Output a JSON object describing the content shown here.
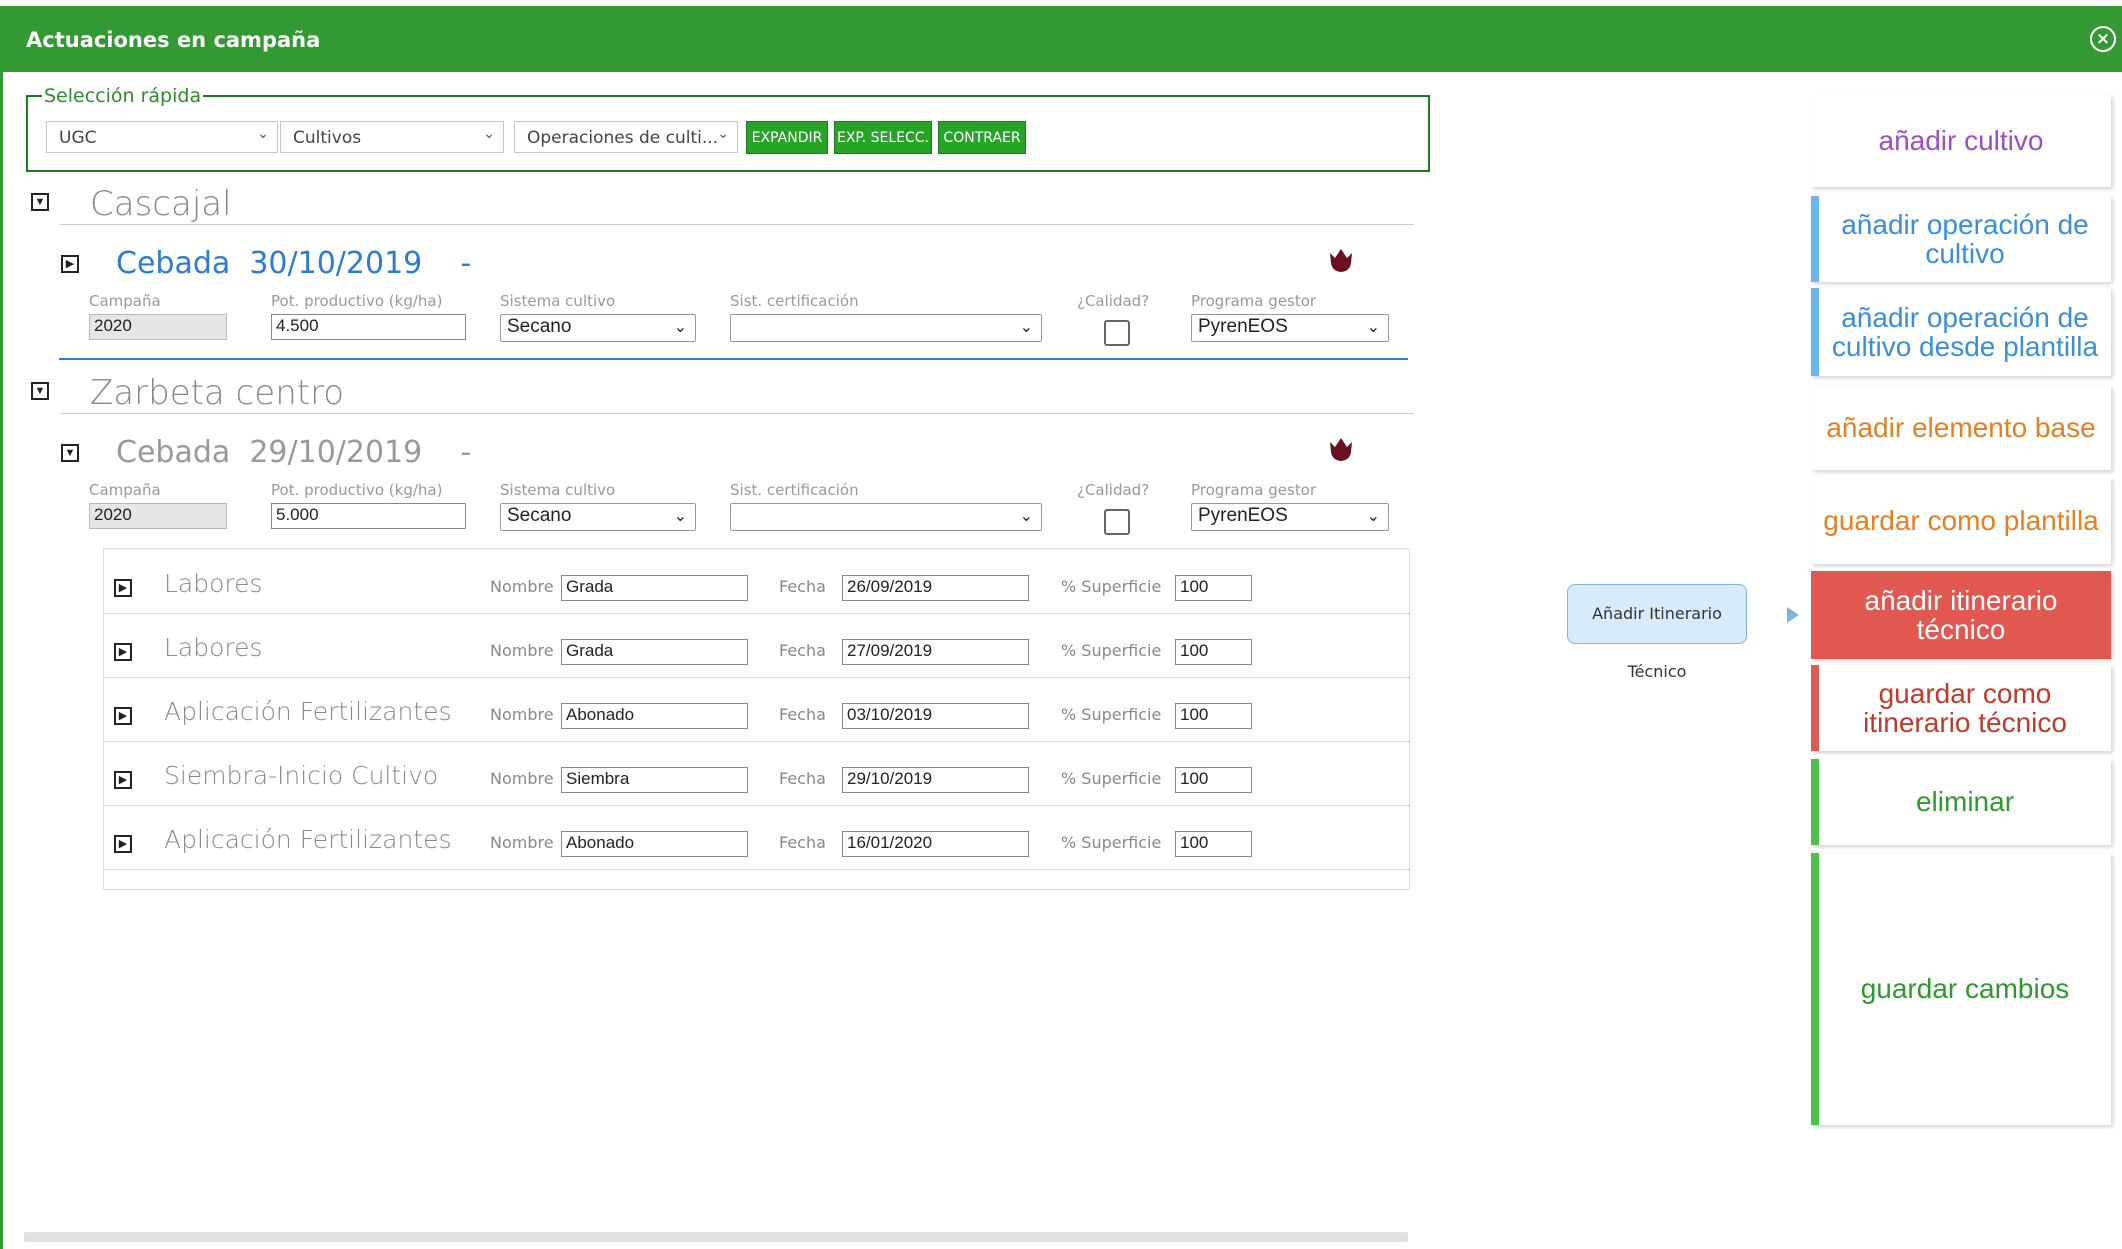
{
  "header": {
    "title": "Actuaciones en campaña",
    "close_icon": "close-circle-icon"
  },
  "quick_select": {
    "legend": "Selección rápida",
    "filters": [
      {
        "value": "UGC"
      },
      {
        "value": "Cultivos"
      },
      {
        "value": "Operaciones de culti..."
      }
    ],
    "buttons": [
      "EXPANDIR",
      "EXP. SELECC.",
      "CONTRAER"
    ]
  },
  "labels": {
    "campana": "Campaña",
    "pot": "Pot. productivo (kg/ha)",
    "sistema": "Sistema cultivo",
    "cert": "Sist. certificación",
    "calidad": "¿Calidad?",
    "programa": "Programa gestor",
    "nombre": "Nombre",
    "fecha": "Fecha",
    "superficie": "% Superficie"
  },
  "sections": [
    {
      "name": "Cascajal",
      "crop": {
        "name": "Cebada",
        "date": "30/10/2019",
        "dash": "-",
        "campana": "2020",
        "pot": "4.500",
        "sistema": "Secano",
        "cert": "",
        "programa": "PyrenEOS"
      }
    },
    {
      "name": "Zarbeta centro",
      "crop": {
        "name": "Cebada",
        "date": "29/10/2019",
        "dash": "-",
        "campana": "2020",
        "pot": "5.000",
        "sistema": "Secano",
        "cert": "",
        "programa": "PyrenEOS"
      }
    }
  ],
  "operations": [
    {
      "type": "Labores",
      "nombre": "Grada",
      "fecha": "26/09/2019",
      "superficie": "100"
    },
    {
      "type": "Labores",
      "nombre": "Grada",
      "fecha": "27/09/2019",
      "superficie": "100"
    },
    {
      "type": "Aplicación Fertilizantes",
      "nombre": "Abonado",
      "fecha": "03/10/2019",
      "superficie": "100"
    },
    {
      "type": "Siembra-Inicio Cultivo",
      "nombre": "Siembra",
      "fecha": "29/10/2019",
      "superficie": "100"
    },
    {
      "type": "Aplicación Fertilizantes",
      "nombre": "Abonado",
      "fecha": "16/01/2020",
      "superficie": "100"
    }
  ],
  "actions": [
    "añadir cultivo",
    "añadir operación de cultivo",
    "añadir operación de cultivo desde plantilla",
    "añadir elemento base",
    "guardar como plantilla",
    "añadir itinerario técnico",
    "guardar como itinerario técnico",
    "eliminar",
    "guardar cambios"
  ],
  "tooltip": "Añadir Itinerario Técnico",
  "colors": {
    "header_green": "#339933",
    "crop_blue": "#2e7bd1",
    "crop_gray": "#999999",
    "purple": "#9b4fc0",
    "blue_action": "#3a8fdc",
    "orange": "#e67e22",
    "red_active": "#e0584f",
    "red_text": "#c0392b",
    "green_text": "#2e9a2e"
  }
}
